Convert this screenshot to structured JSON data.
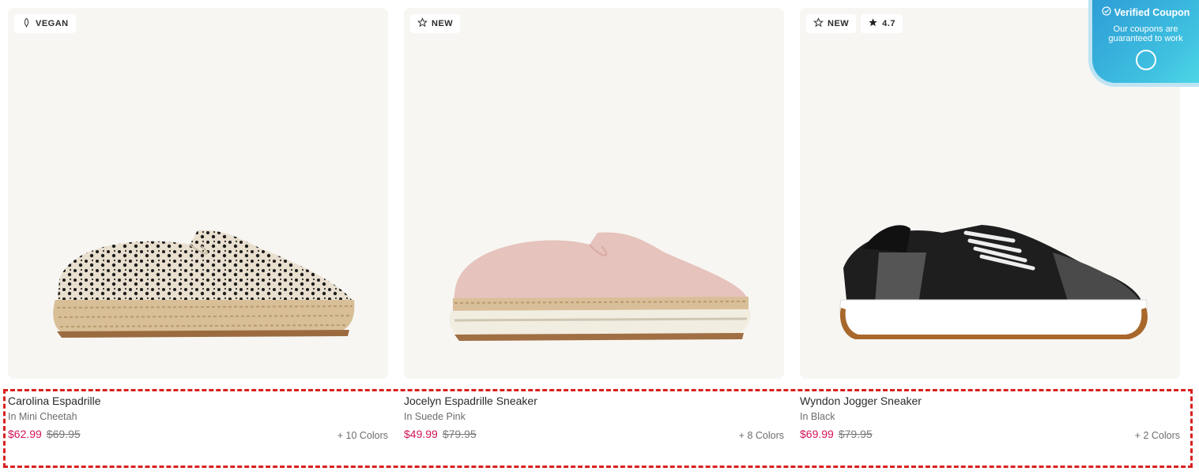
{
  "products": [
    {
      "badges": [
        {
          "icon": "leaf-icon",
          "label": "VEGAN"
        }
      ],
      "name": "Carolina Espadrille",
      "variant": "In Mini Cheetah",
      "sale_price": "$62.99",
      "original_price": "$69.95",
      "colors": "+ 10 Colors"
    },
    {
      "badges": [
        {
          "icon": "star-outline-icon",
          "label": "NEW"
        }
      ],
      "name": "Jocelyn Espadrille Sneaker",
      "variant": "In Suede Pink",
      "sale_price": "$49.99",
      "original_price": "$79.95",
      "colors": "+ 8 Colors"
    },
    {
      "badges": [
        {
          "icon": "star-outline-icon",
          "label": "NEW"
        },
        {
          "icon": "star-filled-icon",
          "label": "4.7"
        }
      ],
      "name": "Wyndon Jogger Sneaker",
      "variant": "In Black",
      "sale_price": "$69.99",
      "original_price": "$79.95",
      "colors": "+ 2 Colors"
    }
  ],
  "coupon": {
    "title": "Verified Coupon",
    "text": "Our coupons are guaranteed to work"
  },
  "colors": {
    "sale": "#d1155a",
    "card_bg": "#f7f6f3",
    "highlight": "#d92020",
    "coupon": "#3fc1e0"
  }
}
